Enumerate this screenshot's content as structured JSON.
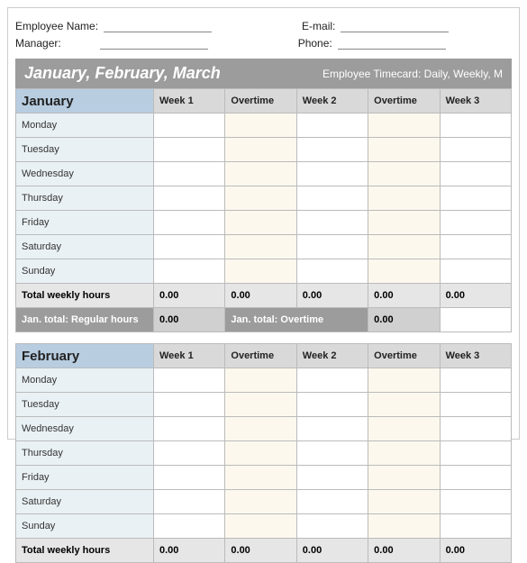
{
  "header": {
    "employee_label": "Employee Name:",
    "email_label": "E-mail:",
    "manager_label": "Manager:",
    "phone_label": "Phone:"
  },
  "banner": {
    "title": "January, February, March",
    "subtitle": "Employee Timecard: Daily, Weekly, M"
  },
  "columns": [
    "Week 1",
    "Overtime",
    "Week 2",
    "Overtime",
    "Week 3"
  ],
  "days": [
    "Monday",
    "Tuesday",
    "Wednesday",
    "Thursday",
    "Friday",
    "Saturday",
    "Sunday"
  ],
  "total_row_label": "Total weekly hours",
  "totals": [
    "0.00",
    "0.00",
    "0.00",
    "0.00",
    "0.00"
  ],
  "months": [
    {
      "name": "January",
      "mtot_reg_label": "Jan. total: Regular hours",
      "mtot_reg_val": "0.00",
      "mtot_ot_label": "Jan. total: Overtime",
      "mtot_ot_val": "0.00"
    },
    {
      "name": "February"
    }
  ]
}
